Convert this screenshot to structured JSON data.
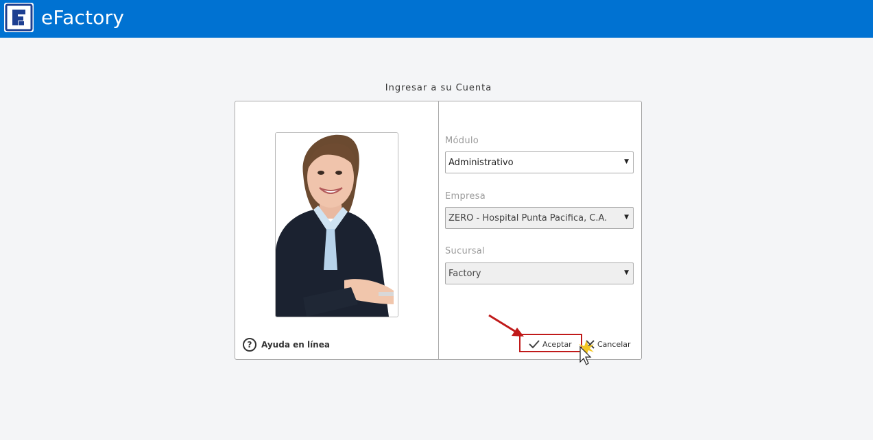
{
  "header": {
    "logo_icon": "efactory-logo-icon",
    "app_name": "eFactory",
    "bar_color": "#0072d2"
  },
  "login": {
    "heading": "Ingresar a su Cuenta",
    "help_label": "Ayuda en línea",
    "fields": {
      "module": {
        "label": "Módulo",
        "value": "Administrativo"
      },
      "company": {
        "label": "Empresa",
        "value": "ZERO - Hospital Punta Pacifica, C.A."
      },
      "branch": {
        "label": "Sucursal",
        "value": "Factory"
      }
    },
    "accept_label": "Aceptar",
    "cancel_label": "Cancelar"
  },
  "annotation": {
    "highlight_color": "#c01a1a",
    "cursor_icon": "mouse-pointer-icon",
    "arrow_icon": "pointer-arrow-icon"
  }
}
